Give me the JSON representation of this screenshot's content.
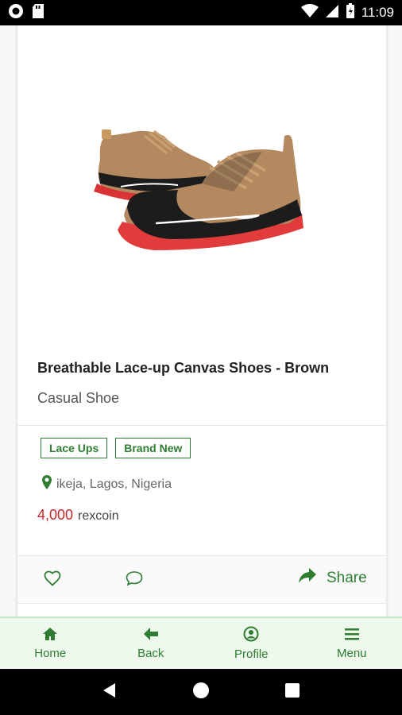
{
  "status_bar": {
    "time": "11:09"
  },
  "product": {
    "title": "Breathable Lace-up Canvas Shoes - Brown",
    "category": "Casual Shoe",
    "tags": [
      "Lace Ups",
      "Brand New"
    ],
    "location": "ikeja, Lagos, Nigeria",
    "price_amount": "4,000",
    "price_unit": "rexcoin",
    "image_icon": "brown-canvas-shoes-photo"
  },
  "actions": {
    "share_label": "Share"
  },
  "bottom_nav": {
    "items": [
      {
        "label": "Home",
        "icon": "home-icon"
      },
      {
        "label": "Back",
        "icon": "back-arrow-icon"
      },
      {
        "label": "Profile",
        "icon": "profile-icon"
      },
      {
        "label": "Menu",
        "icon": "menu-icon"
      }
    ]
  },
  "colors": {
    "accent": "#2e7d32",
    "price": "#c62828",
    "nav_bg": "#eef8ec"
  }
}
